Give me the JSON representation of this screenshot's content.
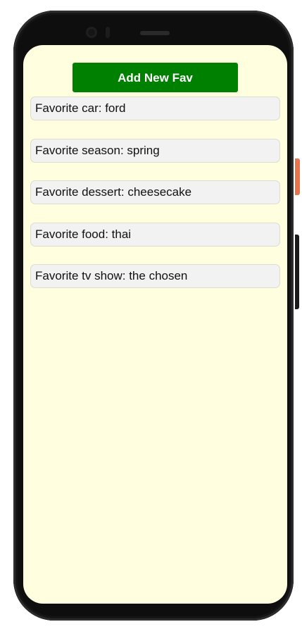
{
  "app": {
    "add_button_label": "Add New Fav"
  },
  "favorites": [
    {
      "label": "Favorite car: ford"
    },
    {
      "label": "Favorite season: spring"
    },
    {
      "label": "Favorite dessert: cheesecake"
    },
    {
      "label": "Favorite food: thai"
    },
    {
      "label": "Favorite tv show: the chosen"
    }
  ],
  "colors": {
    "screen_background": "#ffffe0",
    "button_background": "#008000",
    "button_text": "#ffffff",
    "item_background": "#f2f2f2"
  }
}
